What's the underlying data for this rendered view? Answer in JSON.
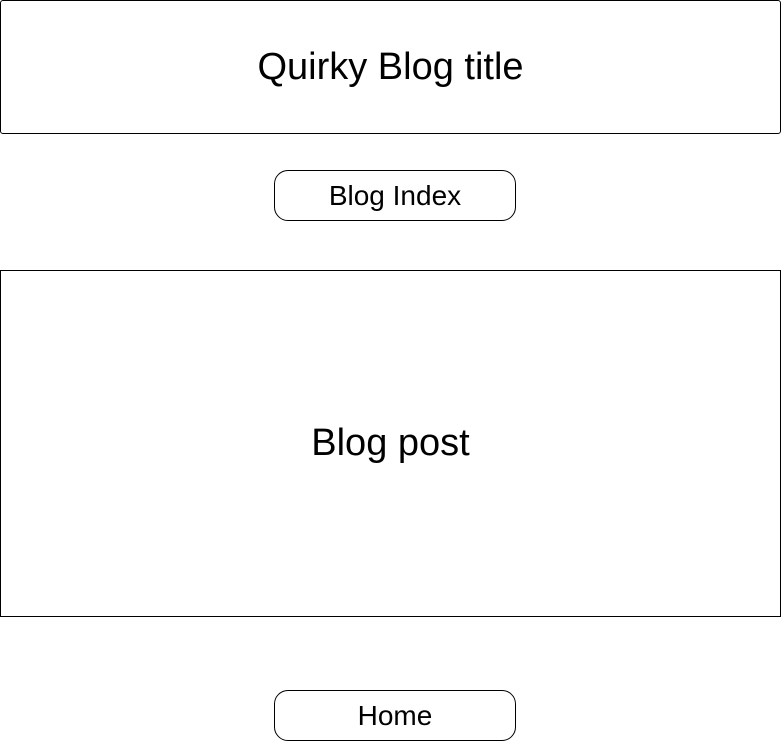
{
  "header": {
    "title": "Quirky Blog title"
  },
  "nav": {
    "blog_index_label": "Blog Index"
  },
  "main": {
    "post_label": "Blog post"
  },
  "footer": {
    "home_label": "Home"
  },
  "colors": {
    "stroke": "#000000",
    "background": "#ffffff"
  }
}
